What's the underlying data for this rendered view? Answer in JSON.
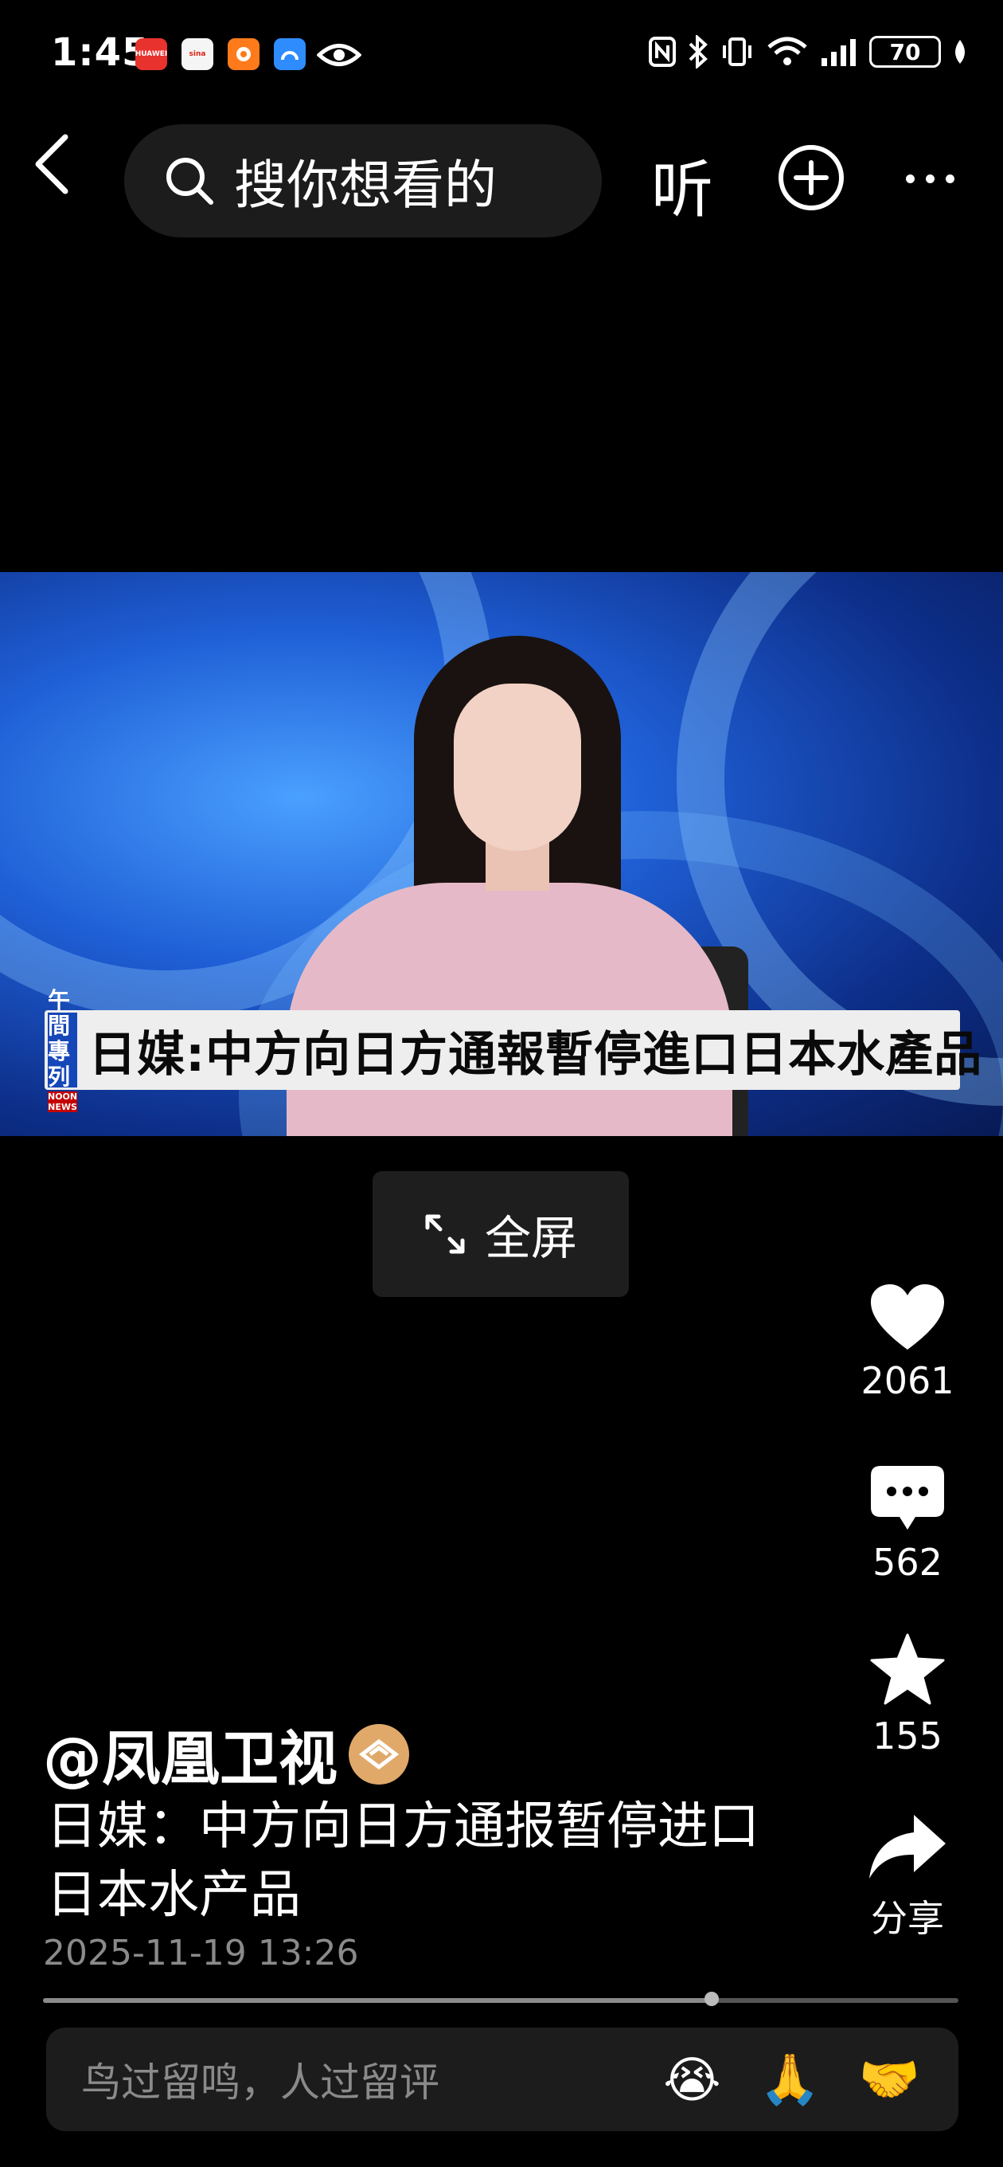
{
  "status_bar": {
    "time": "1:45",
    "battery": "70",
    "apps": [
      {
        "name": "huawei-app-icon",
        "label": "HUAWEI",
        "color": "#e8322e"
      },
      {
        "name": "sina-app-icon",
        "label": "sina",
        "color": "#f5f5f5"
      },
      {
        "name": "orange-app-icon",
        "label": "",
        "color": "#ff7a1a"
      },
      {
        "name": "blue-app-icon",
        "label": "",
        "color": "#2f8cff"
      }
    ]
  },
  "header": {
    "search_placeholder": "搜你想看的",
    "listen_label": "听"
  },
  "video": {
    "banner_logo_line1": "午間",
    "banner_logo_line2": "專列",
    "banner_logo_line3": "NOON NEWS",
    "banner_text": "日媒:中方向日方通報暫停進口日本水產品",
    "fullscreen_label": "全屏"
  },
  "actions": {
    "like_count": "2061",
    "comment_count": "562",
    "favorite_count": "155",
    "share_label": "分享"
  },
  "post": {
    "author": "@凤凰卫视",
    "caption": "日媒：中方向日方通报暂停进口日本水产品",
    "timestamp": "2025-11-19 13:26",
    "progress": 0.73
  },
  "comment_bar": {
    "placeholder": "鸟过留鸣，人过留评",
    "emojis": [
      "😭",
      "🙏",
      "🤝"
    ]
  },
  "colors": {
    "background": "#000000",
    "panel": "#1c1c1c",
    "muted_text": "#8a8a8a",
    "verified_badge": "#e0a96a"
  }
}
